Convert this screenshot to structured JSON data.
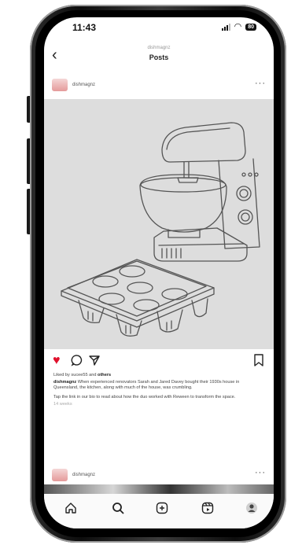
{
  "status": {
    "time": "11:43",
    "battery": "80"
  },
  "header": {
    "back_label": "‹",
    "username": "dishmagnz",
    "title": "Posts"
  },
  "post": {
    "username": "dishmagnz",
    "more_label": "···",
    "likes_prefix": "Liked by",
    "liked_user": "sucee55",
    "likes_suffix": "and",
    "likes_others": "others",
    "caption_user": "dishmagnz",
    "caption_body": "When experienced renovators Sarah and Jared Davey bought their 1930s house in Queensland, the kitchen, along with much of the house, was crumbling.",
    "caption_extra": "Tap the link in our bio to read about how the duo worked with Reween to transform the space.",
    "timestamp": "14 weeks"
  },
  "next_post": {
    "username": "dishmagnz",
    "more_label": "···"
  },
  "icons": {
    "back": "chevron-left-icon",
    "like": "heart-icon",
    "comment": "comment-icon",
    "share": "send-icon",
    "save": "bookmark-icon",
    "home": "home-icon",
    "search": "search-icon",
    "create": "add-post-icon",
    "reels": "reels-icon",
    "profile": "profile-icon"
  },
  "colors": {
    "like": "#e0102c",
    "image_bg": "#dddddd"
  }
}
